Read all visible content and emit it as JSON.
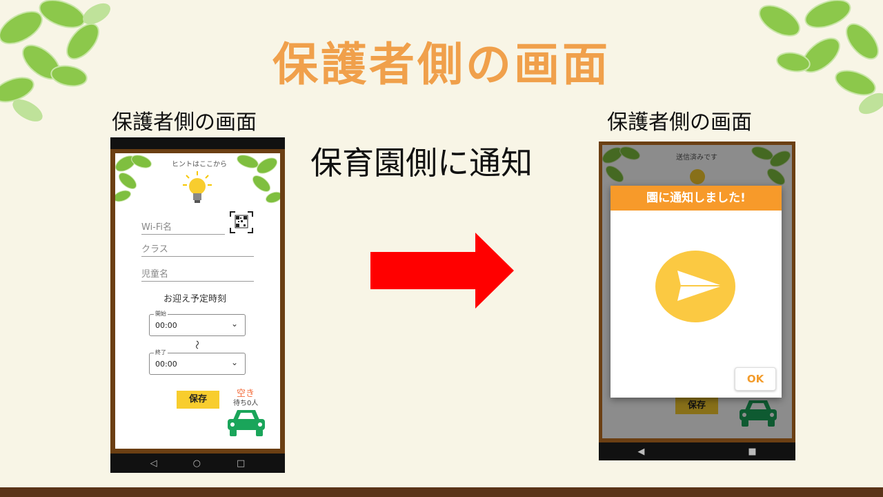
{
  "slide": {
    "title": "保護者側の画面",
    "left_caption": "保護者側の画面",
    "right_caption": "保護者側の画面",
    "notify_text": "保育園側に通知"
  },
  "left_phone": {
    "hint": "ヒントはここから",
    "wifi_placeholder": "Wi-Fi名",
    "class_placeholder": "クラス",
    "child_placeholder": "児童名",
    "pickup_heading": "お迎え予定時刻",
    "start_legend": "開始",
    "start_value": "00:00",
    "tilde": "〜",
    "end_legend": "終了",
    "end_value": "00:00",
    "save_label": "保存",
    "status": "空き",
    "waiting": "待ち0人",
    "nav": [
      "◁",
      "○",
      "□"
    ]
  },
  "right_phone": {
    "hint": "送信済みです",
    "dialog_title": "園に通知しました!",
    "ok_label": "OK",
    "save_label": "保存",
    "nav": [
      "◀",
      "■"
    ]
  },
  "colors": {
    "background": "#f8f5e6",
    "title": "#f0a04b",
    "accent_yellow": "#f8cd2e",
    "dialog_header": "#f79a2a",
    "car_green": "#1aa55a",
    "arrow_red": "#ff0000",
    "wood": "#6b3f13"
  },
  "icons": [
    "leaf-cluster-icon",
    "lightbulb-icon",
    "qr-code-icon",
    "chevron-down-icon",
    "car-icon",
    "paper-plane-icon",
    "arrow-right-icon"
  ]
}
